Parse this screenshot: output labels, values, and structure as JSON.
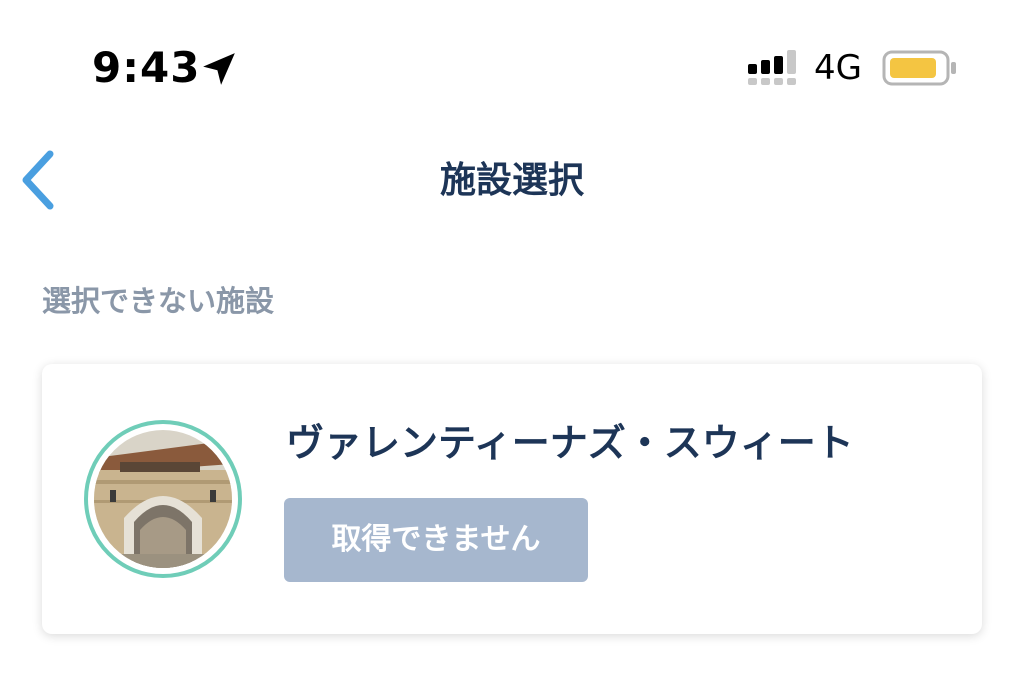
{
  "status_bar": {
    "time": "9:43",
    "network": "4G",
    "icons": {
      "location": "location-arrow-icon",
      "signal": "cellular-signal-icon",
      "battery": "battery-icon"
    },
    "battery_color": "#f4c542"
  },
  "nav": {
    "back_icon": "chevron-left-icon",
    "title": "施設選択"
  },
  "section": {
    "label": "選択できない施設"
  },
  "facility": {
    "name": "ヴァレンティーナズ・スウィート",
    "button_label": "取得できません",
    "photo_ring_color": "#6fcdb8"
  },
  "colors": {
    "title": "#1d3557",
    "accent": "#4a9fe0",
    "disabled_button": "#a6b7ce",
    "section_label": "#8a97a8"
  }
}
